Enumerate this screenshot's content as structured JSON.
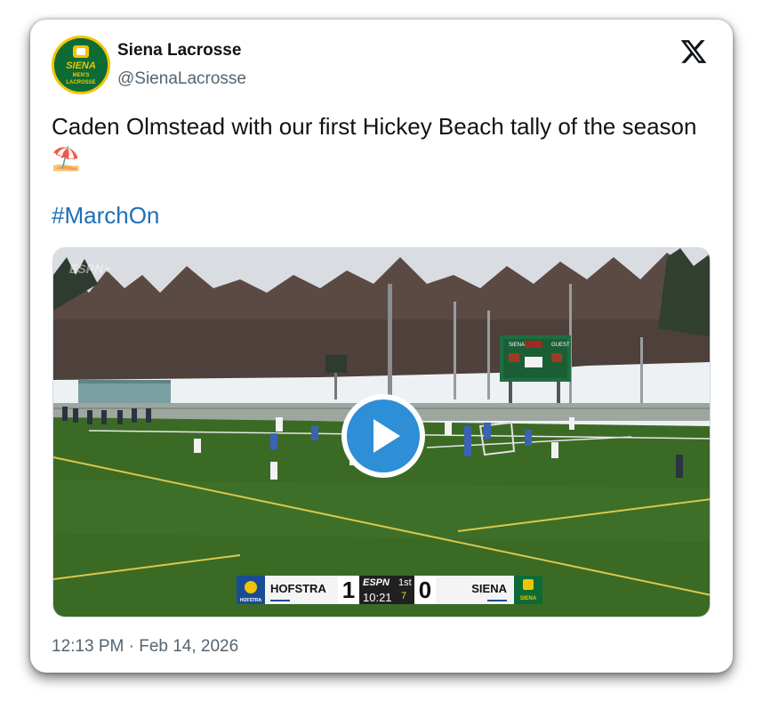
{
  "tweet": {
    "author_name": "Siena Lacrosse",
    "author_handle": "@SienaLacrosse",
    "avatar_text": {
      "line1": "SIENA",
      "line2": "MEN'S",
      "line3": "LACROSSE"
    },
    "text": "Caden Olmstead with our first Hickey Beach tally of the season ⛱️",
    "hashtag": "#MarchOn",
    "timestamp": "12:13 PM · Feb 14, 2026"
  },
  "video": {
    "watermark": "ESPN+",
    "stadium_board": {
      "home": "SIENA",
      "guest": "GUEST"
    },
    "scorebug": {
      "away_team": "HOFSTRA",
      "away_score": "1",
      "network": "ESPN",
      "period": "1st",
      "clock": "10:21",
      "shot_clock": "7",
      "home_score": "0",
      "home_team": "SIENA",
      "away_logo_text": "HOFSTRA",
      "home_logo_text": "SIENA"
    }
  },
  "icons": {
    "platform": "x-logo-icon",
    "play": "play-icon"
  },
  "colors": {
    "hashtag": "#1d6fb8",
    "play_button": "#2e8ed6",
    "siena_green": "#0d6b35",
    "siena_gold": "#f1c400",
    "hofstra_blue": "#1a4c96"
  }
}
